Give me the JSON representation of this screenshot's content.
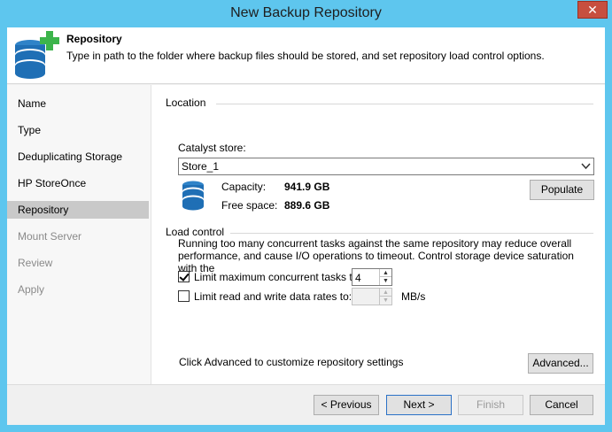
{
  "window": {
    "title": "New Backup Repository",
    "close_glyph": "✕"
  },
  "header": {
    "icon": "database-add-icon",
    "title": "Repository",
    "description": "Type in path to the folder where backup files should be stored, and set repository load control options."
  },
  "sidebar": {
    "items": [
      {
        "label": "Name",
        "state": "normal"
      },
      {
        "label": "Type",
        "state": "normal"
      },
      {
        "label": "Deduplicating Storage",
        "state": "normal"
      },
      {
        "label": "HP StoreOnce",
        "state": "normal"
      },
      {
        "label": "Repository",
        "state": "active"
      },
      {
        "label": "Mount Server",
        "state": "disabled"
      },
      {
        "label": "Review",
        "state": "disabled"
      },
      {
        "label": "Apply",
        "state": "disabled"
      }
    ]
  },
  "location": {
    "group_label": "Location",
    "store_label": "Catalyst store:",
    "store_value": "Store_1",
    "capacity_label": "Capacity:",
    "capacity_value": "941.9 GB",
    "free_label": "Free space:",
    "free_value": "889.6 GB",
    "populate_label": "Populate"
  },
  "load_control": {
    "group_label": "Load control",
    "description": "Running too many concurrent tasks against the same repository may reduce overall performance, and cause I/O operations to timeout. Control storage device saturation with the",
    "limit_tasks_label": "Limit maximum concurrent tasks to:",
    "limit_tasks_checked": true,
    "limit_tasks_value": "4",
    "limit_rate_label": "Limit read and write data rates to:",
    "limit_rate_checked": false,
    "limit_rate_value": "",
    "limit_rate_unit": "MB/s"
  },
  "advanced": {
    "hint": "Click Advanced to customize repository settings",
    "button_label": "Advanced..."
  },
  "footer": {
    "previous_label": "< Previous",
    "next_label": "Next >",
    "finish_label": "Finish",
    "cancel_label": "Cancel"
  },
  "colors": {
    "title_bar": "#5ec6ee",
    "close_button": "#c74f3f",
    "icon_blue": "#1f6fb5",
    "icon_green": "#3cb44b",
    "focus_border": "#2b72c7"
  }
}
